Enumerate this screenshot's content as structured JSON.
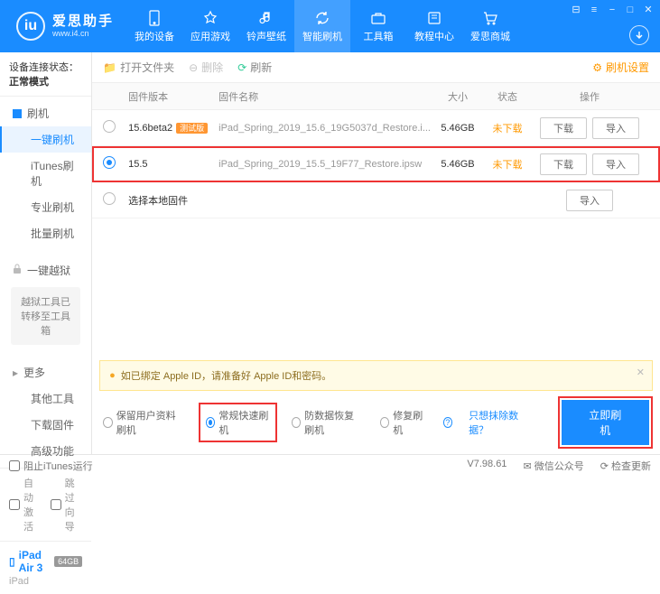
{
  "app": {
    "name_cn": "爱思助手",
    "name_en": "www.i4.cn"
  },
  "nav": {
    "items": [
      {
        "label": "我的设备"
      },
      {
        "label": "应用游戏"
      },
      {
        "label": "铃声壁纸"
      },
      {
        "label": "智能刷机"
      },
      {
        "label": "工具箱"
      },
      {
        "label": "教程中心"
      },
      {
        "label": "爱思商城"
      }
    ]
  },
  "sidebar": {
    "conn_label": "设备连接状态：",
    "conn_value": "正常模式",
    "group_flash": "刷机",
    "items_flash": [
      "一键刷机",
      "iTunes刷机",
      "专业刷机",
      "批量刷机"
    ],
    "group_jailbreak": "一键越狱",
    "jailbreak_note": "越狱工具已转移至工具箱",
    "group_more": "更多",
    "items_more": [
      "其他工具",
      "下载固件",
      "高级功能"
    ],
    "auto_activate": "自动激活",
    "skip_guide": "跳过向导",
    "device_name": "iPad Air 3",
    "device_storage": "64GB",
    "device_type": "iPad"
  },
  "toolbar": {
    "open_folder": "打开文件夹",
    "delete": "删除",
    "refresh": "刷新",
    "settings": "刷机设置"
  },
  "table": {
    "headers": {
      "version": "固件版本",
      "name": "固件名称",
      "size": "大小",
      "status": "状态",
      "ops": "操作"
    },
    "rows": [
      {
        "version": "15.6beta2",
        "beta_tag": "测试版",
        "name": "iPad_Spring_2019_15.6_19G5037d_Restore.i...",
        "size": "5.46GB",
        "status": "未下载",
        "selected": false
      },
      {
        "version": "15.5",
        "beta_tag": "",
        "name": "iPad_Spring_2019_15.5_19F77_Restore.ipsw",
        "size": "5.46GB",
        "status": "未下载",
        "selected": true
      }
    ],
    "local_fw": "选择本地固件",
    "btn_download": "下载",
    "btn_import": "导入"
  },
  "alert": "如已绑定 Apple ID，请准备好 Apple ID和密码。",
  "options": {
    "keep_data": "保留用户资料刷机",
    "normal": "常规快速刷机",
    "recovery": "防数据恢复刷机",
    "repair": "修复刷机",
    "exclude_link": "只想抹除数据？",
    "flash_btn": "立即刷机"
  },
  "statusbar": {
    "block_itunes": "阻止iTunes运行",
    "version": "V7.98.61",
    "wechat": "微信公众号",
    "check_update": "检查更新"
  }
}
